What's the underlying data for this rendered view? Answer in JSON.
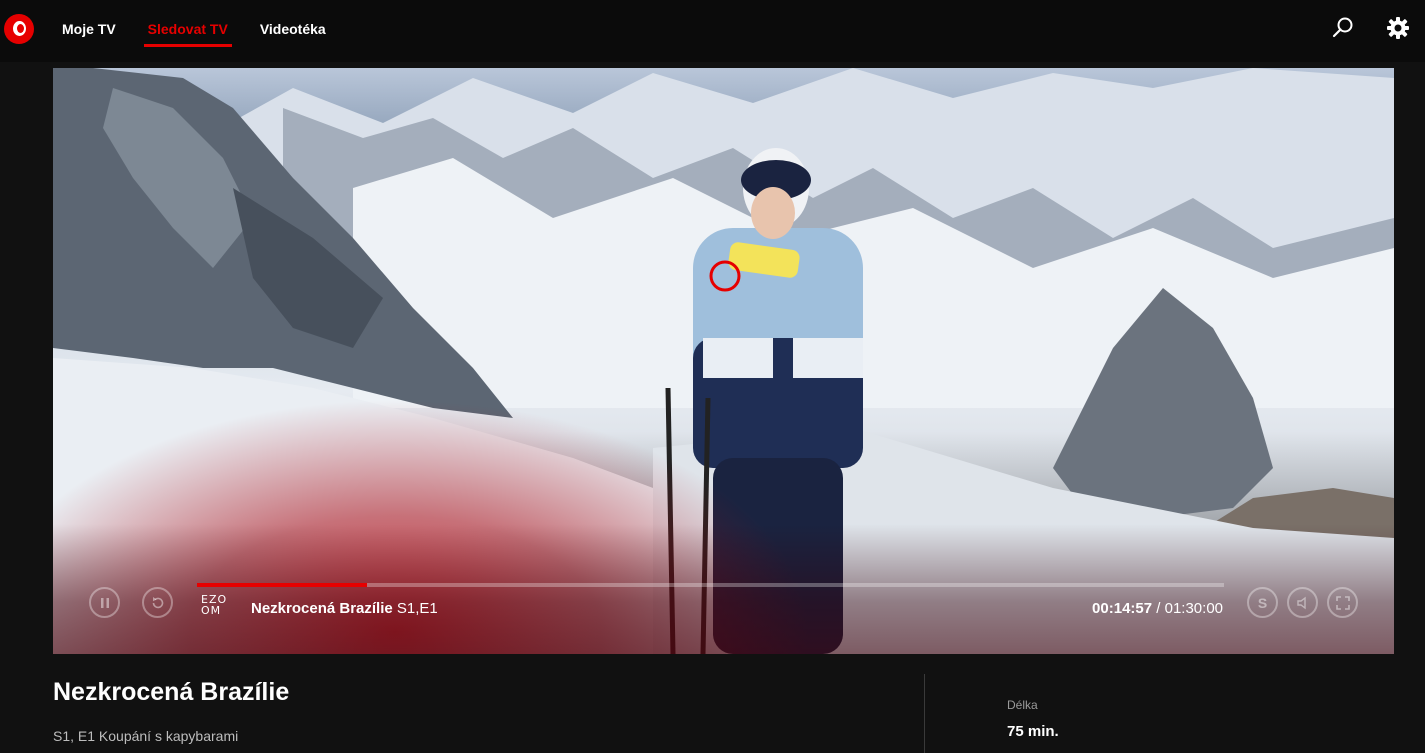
{
  "nav": {
    "items": [
      {
        "label": "Moje TV",
        "active": false
      },
      {
        "label": "Sledovat TV",
        "active": true
      },
      {
        "label": "Videotéka",
        "active": false
      }
    ],
    "icons": [
      "search-icon",
      "settings-icon"
    ]
  },
  "player": {
    "channel_logo_lines": [
      "EZO",
      "OM"
    ],
    "show_title": "Nezkrocená Brazílie",
    "episode": "S1,E1",
    "current_time": "00:14:57",
    "separator": "/",
    "total_time": "01:30:00",
    "progress": 0.166,
    "buttons": [
      "pause-icon",
      "restart-icon",
      "subtitles-icon",
      "volume-icon",
      "fullscreen-icon"
    ],
    "subtitles_label": "S"
  },
  "info": {
    "title": "Nezkrocená Brazílie",
    "subtitle": "S1, E1 Koupání s kapybarami",
    "meta_label": "Délka",
    "meta_value": "75 min."
  },
  "colors": {
    "accent": "#e60000",
    "background": "#111111",
    "topbar": "#0b0b0b"
  }
}
